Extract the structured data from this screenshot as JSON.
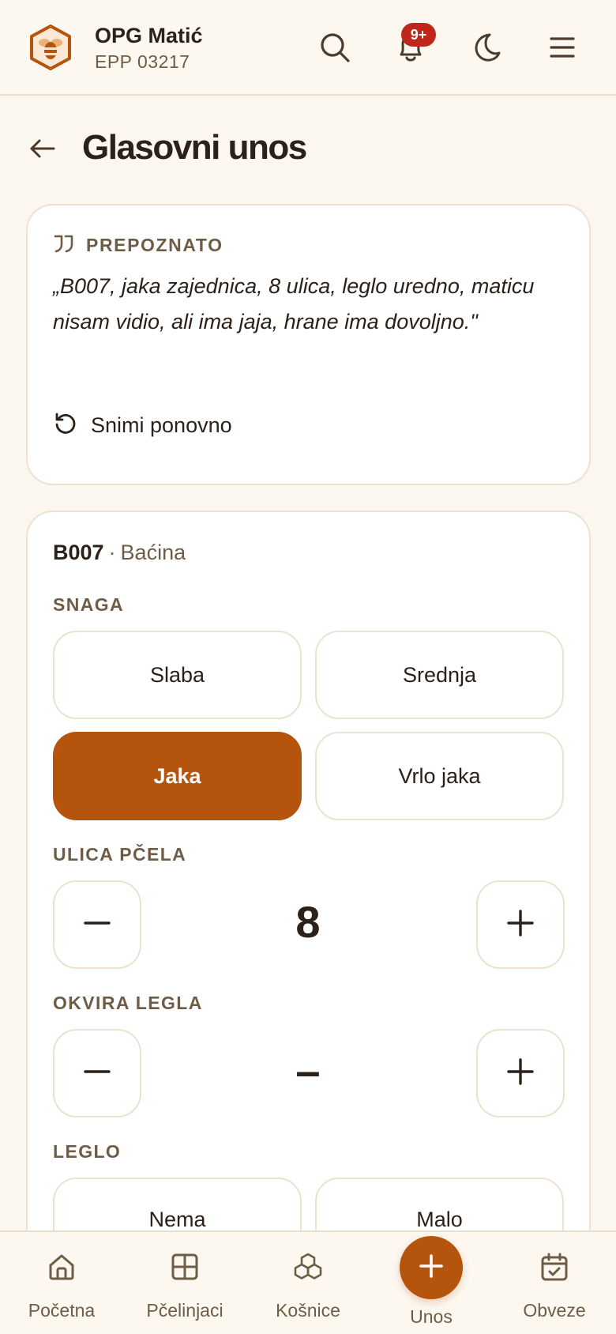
{
  "header": {
    "brand_name": "OPG Matić",
    "brand_sub": "EPP 03217",
    "notification_badge": "9+",
    "icons": [
      "search-icon",
      "bell-icon",
      "moon-icon",
      "menu-icon"
    ]
  },
  "page": {
    "title": "Glasovni unos"
  },
  "recognized": {
    "label": "PREPOZNATO",
    "text": "„B007, jaka zajednica, 8 ulica, leglo uredno, maticu nisam vidio, ali ima jaja, hrane ima dovoljno.\"",
    "rerecord_label": "Snimi ponovno"
  },
  "hive": {
    "code": "B007",
    "separator": "·",
    "location": "Baćina"
  },
  "strength": {
    "label": "SNAGA",
    "options": [
      "Slaba",
      "Srednja",
      "Jaka",
      "Vrlo jaka"
    ],
    "selected": "Jaka"
  },
  "streets": {
    "label": "ULICA PČELA",
    "value": "8"
  },
  "brood_frames": {
    "label": "OKVIRA LEGLA",
    "value": "–"
  },
  "brood": {
    "label": "LEGLO",
    "options": [
      "Nema",
      "Malo"
    ]
  },
  "bottom_nav": {
    "items": [
      {
        "label": "Početna",
        "icon": "home-icon"
      },
      {
        "label": "Pčelinjaci",
        "icon": "grid-icon"
      },
      {
        "label": "Košnice",
        "icon": "boxes-icon"
      },
      {
        "label": "Unos",
        "icon": "plus-icon"
      },
      {
        "label": "Obveze",
        "icon": "calendar-check-icon"
      }
    ]
  },
  "colors": {
    "accent": "#b5540c",
    "background": "#fbf7ef",
    "badge": "#c0271c",
    "muted_text": "#6f5c45"
  }
}
